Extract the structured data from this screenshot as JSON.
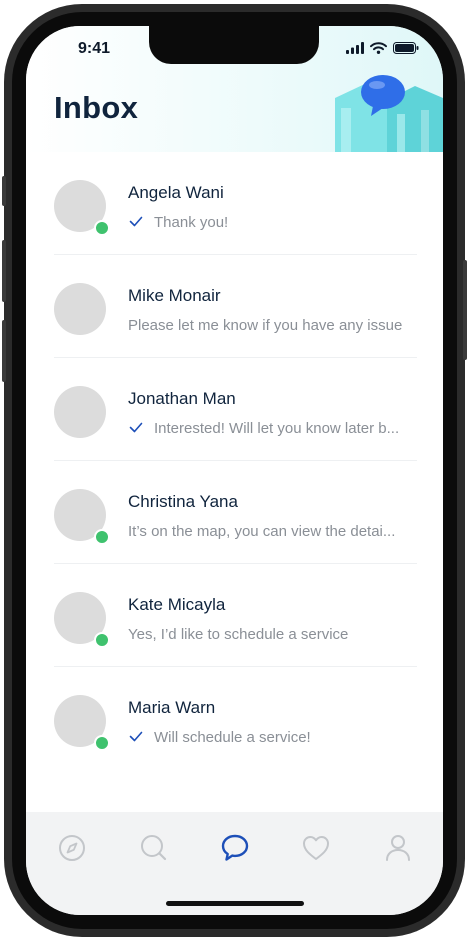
{
  "status_bar": {
    "time": "9:41"
  },
  "header": {
    "title": "Inbox"
  },
  "conversations": [
    {
      "name": "Angela Wani",
      "message": "Thank you!",
      "read": true,
      "online": true
    },
    {
      "name": "Mike Monair",
      "message": "Please let me know if you have any issue",
      "read": false,
      "online": false
    },
    {
      "name": "Jonathan Man",
      "message": "Interested! Will let you know later b...",
      "read": true,
      "online": false
    },
    {
      "name": "Christina Yana",
      "message": "It’s on the map, you can view the detai...",
      "read": false,
      "online": true
    },
    {
      "name": "Kate Micayla",
      "message": "Yes, I’d like to schedule a service",
      "read": false,
      "online": true
    },
    {
      "name": "Maria Warn",
      "message": "Will schedule a service!",
      "read": true,
      "online": true
    }
  ],
  "tab_bar": {
    "tabs": [
      "compass-icon",
      "search-icon",
      "chat-bubble-icon",
      "heart-icon",
      "user-icon"
    ],
    "active_tab": "chat-bubble-icon"
  },
  "colors": {
    "accent": "#1d4fb8",
    "online": "#3fc26e",
    "title": "#10243d",
    "message": "#8a8f96",
    "inactive_icon": "#c3c6ca"
  }
}
